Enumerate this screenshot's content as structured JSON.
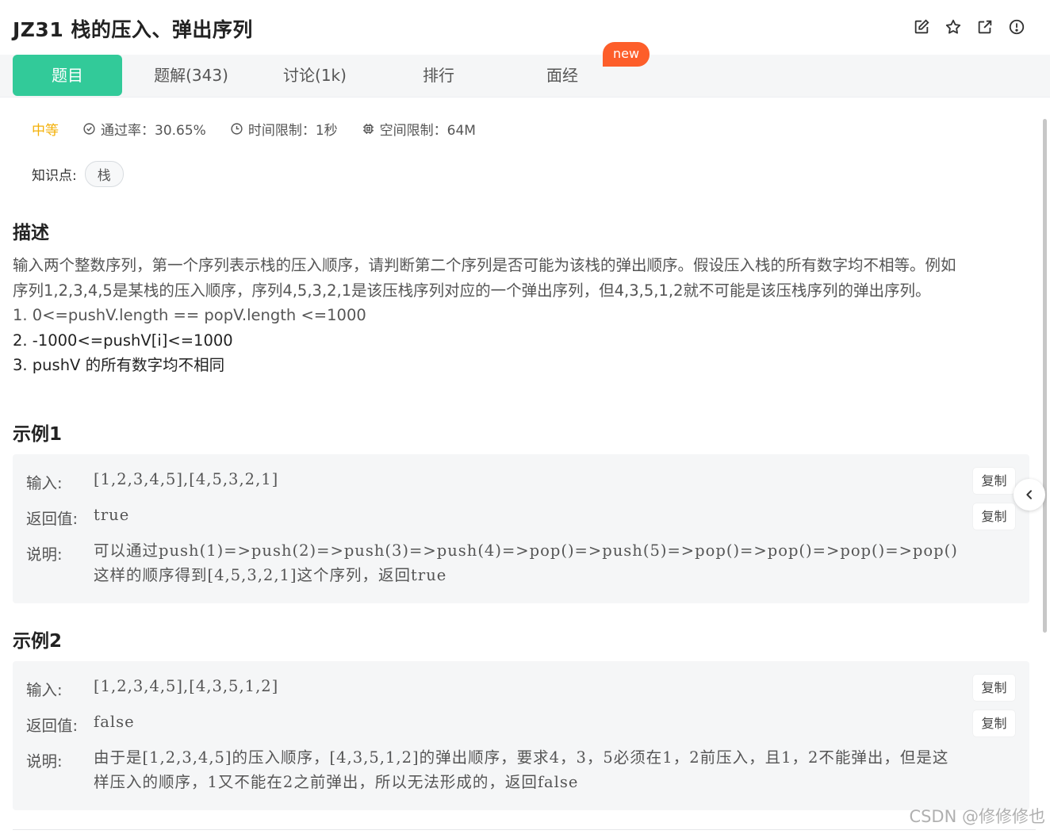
{
  "header": {
    "title": "JZ31  栈的压入、弹出序列",
    "icons": [
      "edit-icon",
      "star-icon",
      "external-link-icon",
      "report-icon"
    ]
  },
  "tabs": [
    {
      "label": "题目",
      "active": true
    },
    {
      "label": "题解(343)"
    },
    {
      "label": "讨论(1k)"
    },
    {
      "label": "排行"
    },
    {
      "label": "面经"
    }
  ],
  "new_badge": "new",
  "meta": {
    "difficulty": "中等",
    "pass_rate": "通过率：30.65%",
    "time_limit": "时间限制：1秒",
    "space_limit": "空间限制：64M"
  },
  "knowledge": {
    "label": "知识点:",
    "tags": [
      "栈"
    ]
  },
  "description": {
    "heading": "描述",
    "lines": [
      "输入两个整数序列，第一个序列表示栈的压入顺序，请判断第二个序列是否可能为该栈的弹出顺序。假设压入栈的所有数字均不相等。例如",
      "序列1,2,3,4,5是某栈的压入顺序，序列4,5,3,2,1是该压栈序列对应的一个弹出序列，但4,3,5,1,2就不可能是该压栈序列的弹出序列。",
      "1. 0<=pushV.length == popV.length <=1000",
      "2. -1000<=pushV[i]<=1000",
      "3. pushV 的所有数字均不相同"
    ]
  },
  "examples": [
    {
      "heading": "示例1",
      "input_label": "输入:",
      "input": "[1,2,3,4,5],[4,5,3,2,1]",
      "return_label": "返回值:",
      "return": "true",
      "explain_label": "说明:",
      "explain": [
        "可以通过push(1)=>push(2)=>push(3)=>push(4)=>pop()=>push(5)=>pop()=>pop()=>pop()=>pop()",
        "这样的顺序得到[4,5,3,2,1]这个序列，返回true"
      ],
      "copy": "复制"
    },
    {
      "heading": "示例2",
      "input_label": "输入:",
      "input": "[1,2,3,4,5],[4,3,5,1,2]",
      "return_label": "返回值:",
      "return": "false",
      "explain_label": "说明:",
      "explain": [
        "由于是[1,2,3,4,5]的压入顺序，[4,3,5,1,2]的弹出顺序，要求4，3，5必须在1，2前压入，且1，2不能弹出，但是这",
        "样压入的顺序，1又不能在2之前弹出，所以无法形成的，返回false"
      ],
      "copy": "复制"
    }
  ],
  "watermark": "CSDN @修修修也",
  "colors": {
    "accent": "#32ca99",
    "badge": "#fd5e2a",
    "difficulty": "#f3b008"
  }
}
